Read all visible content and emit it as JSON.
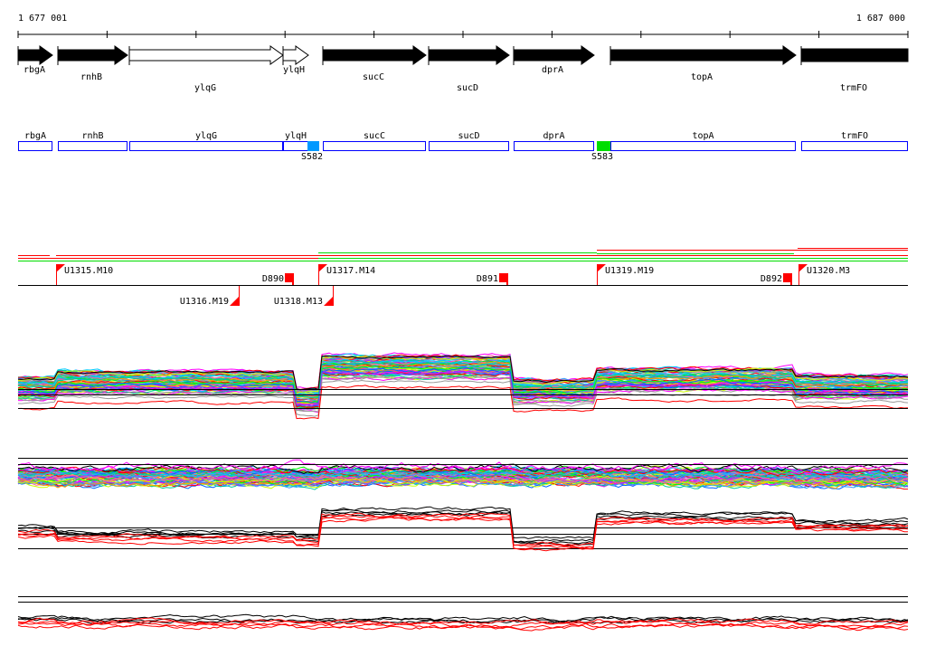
{
  "ruler": {
    "start_label": "1 677 001",
    "end_label": "1 687 000"
  },
  "genes": [
    {
      "name": "rbgA",
      "fill": "#000000"
    },
    {
      "name": "rnhB",
      "fill": "#000000"
    },
    {
      "name": "ylqG",
      "fill": "#ffffff"
    },
    {
      "name": "ylqH",
      "fill": "#ffffff"
    },
    {
      "name": "sucC",
      "fill": "#000000"
    },
    {
      "name": "sucD",
      "fill": "#000000"
    },
    {
      "name": "dprA",
      "fill": "#000000"
    },
    {
      "name": "topA",
      "fill": "#000000"
    },
    {
      "name": "trmFO",
      "fill": "#000000"
    }
  ],
  "sites": [
    {
      "label": "S582",
      "color": "#0099ff"
    },
    {
      "label": "S583",
      "color": "#00dd00"
    }
  ],
  "markers": [
    {
      "label": "U1315.M10",
      "type": "flag-up"
    },
    {
      "label": "U1316.M19",
      "type": "flag-down"
    },
    {
      "label": "D890",
      "type": "square"
    },
    {
      "label": "U1317.M14",
      "type": "flag-up"
    },
    {
      "label": "U1318.M13",
      "type": "flag-down"
    },
    {
      "label": "D891",
      "type": "square"
    },
    {
      "label": "U1319.M19",
      "type": "flag-up"
    },
    {
      "label": "D892",
      "type": "square"
    },
    {
      "label": "U1320.M3",
      "type": "flag-up"
    }
  ],
  "colors": {
    "marker": "#ff0000",
    "gene_box": "#0000ff",
    "track_red": "#ff0000",
    "track_green": "#00dd00"
  }
}
